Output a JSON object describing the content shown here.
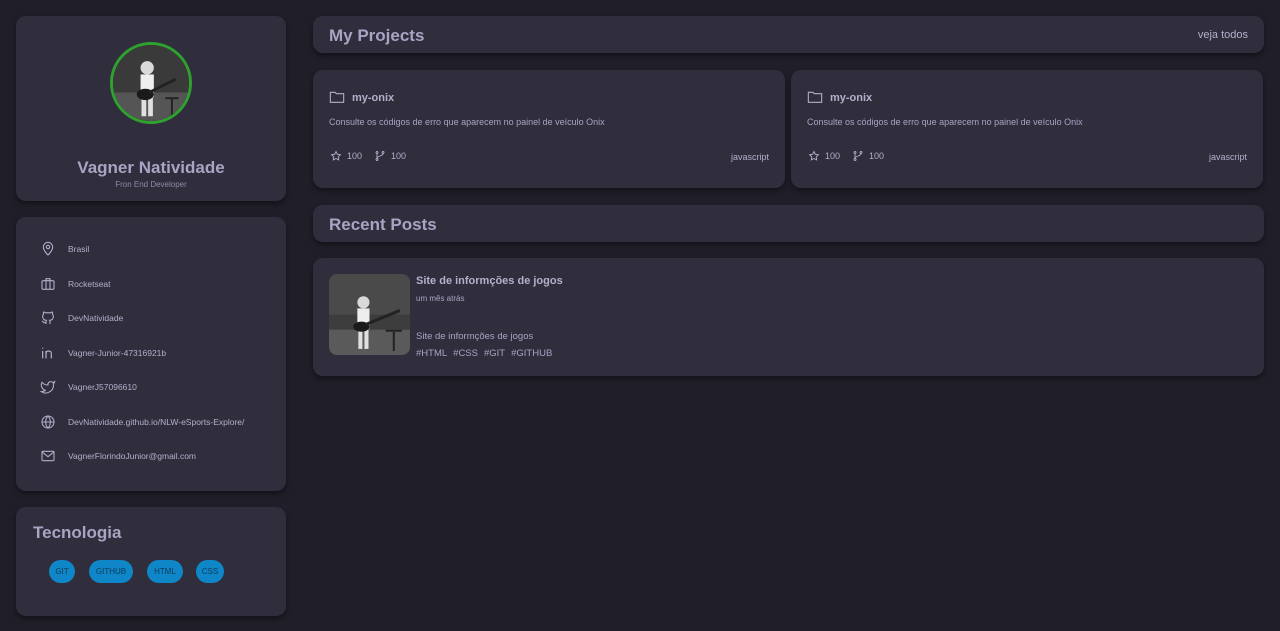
{
  "profile": {
    "name": "Vagner Natividade",
    "role": "Fron End Developer",
    "avatar_ring_color": "#2fa12f"
  },
  "info": {
    "items": [
      {
        "icon": "map-pin-icon",
        "label": "Brasil"
      },
      {
        "icon": "briefcase-icon",
        "label": "Rocketseat"
      },
      {
        "icon": "github-icon",
        "label": "DevNatividade"
      },
      {
        "icon": "linkedin-icon",
        "label": "Vagner-Junior-47316921b"
      },
      {
        "icon": "twitter-icon",
        "label": "VagnerJ57096610"
      },
      {
        "icon": "globe-icon",
        "label": "DevNatividade.github.io/NLW-eSports-Explore/"
      },
      {
        "icon": "mail-icon",
        "label": "VagnerFlorindoJunior@gmail.com"
      }
    ]
  },
  "tech": {
    "title": "Tecnologia",
    "tags": [
      "GIT",
      "GITHUB",
      "HTML",
      "CSS"
    ],
    "tag_color": "#0e86c7"
  },
  "projects_section": {
    "title": "My Projects",
    "view_all": "veja todos"
  },
  "projects": [
    {
      "name": "my-onix",
      "description": "Consulte os códigos de erro que aparecem no painel de veículo Onix",
      "stars": "100",
      "forks": "100",
      "language": "javascript"
    },
    {
      "name": "my-onix",
      "description": "Consulte os códigos de erro que aparecem no painel de veículo Onix",
      "stars": "100",
      "forks": "100",
      "language": "javascript"
    }
  ],
  "posts_section": {
    "title": "Recent Posts"
  },
  "post": {
    "title": "Site de informções de jogos",
    "time": "um mês atrás",
    "body": "Site de informções de jogos",
    "tags": [
      "#HTML",
      "#CSS",
      "#GIT",
      "#GITHUB"
    ]
  },
  "colors": {
    "background": "#201f29",
    "card": "#302e3d",
    "text": "#a9a3c4"
  }
}
